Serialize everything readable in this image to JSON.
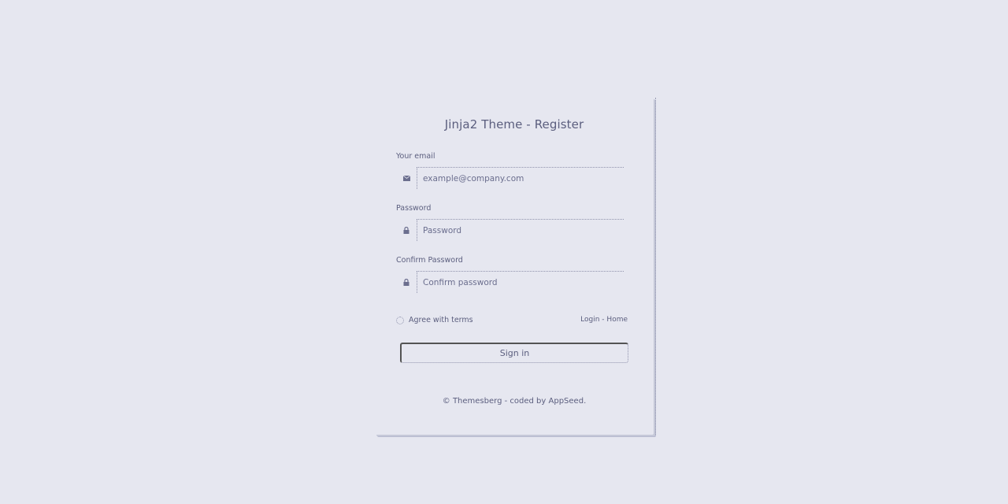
{
  "card": {
    "title": "Jinja2 Theme - Register"
  },
  "fields": {
    "email": {
      "label": "Your email",
      "placeholder": "example@company.com",
      "icon": "envelope-icon"
    },
    "password": {
      "label": "Password",
      "placeholder": "Password",
      "icon": "lock-icon"
    },
    "confirm": {
      "label": "Confirm Password",
      "placeholder": "Confirm password",
      "icon": "lock-icon"
    }
  },
  "agree": {
    "label": "Agree with terms"
  },
  "links": {
    "login": "Login",
    "separator": "-",
    "home": "Home"
  },
  "submit": {
    "label": "Sign in"
  },
  "footer": {
    "copyright": "©",
    "brand": "Themesberg",
    "separator": "- coded by",
    "coder": "AppSeed",
    "end": "."
  }
}
